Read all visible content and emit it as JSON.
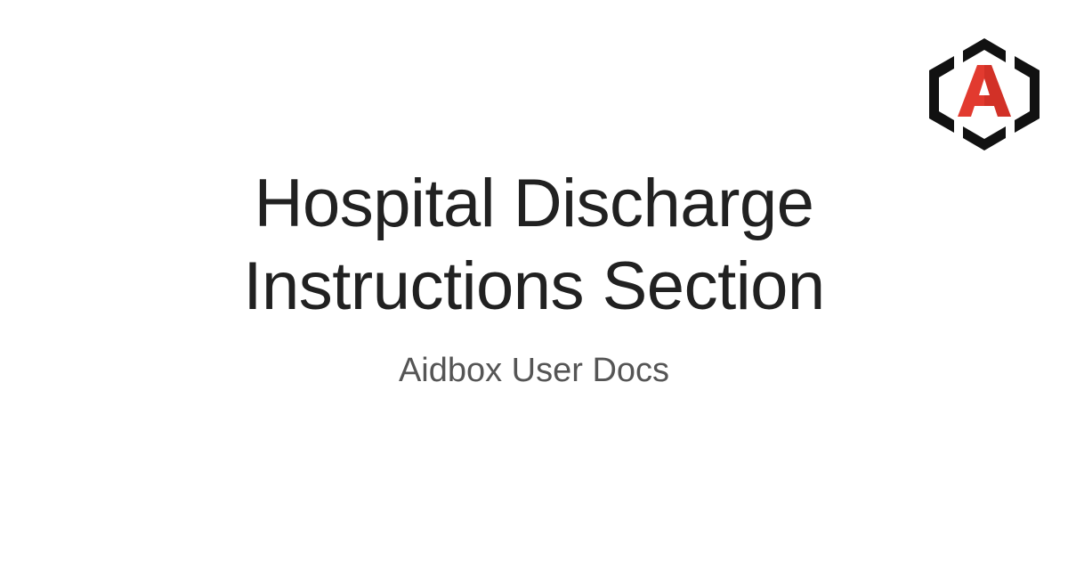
{
  "page": {
    "title": "Hospital Discharge Instructions Section",
    "subtitle": "Aidbox User Docs"
  },
  "logo": {
    "letter": "A",
    "icon": "aidbox-logo-icon",
    "frame_color": "#111111",
    "letter_color": "#e23a2f"
  },
  "colors": {
    "background": "#ffffff",
    "title": "#212121",
    "subtitle": "#555555"
  }
}
